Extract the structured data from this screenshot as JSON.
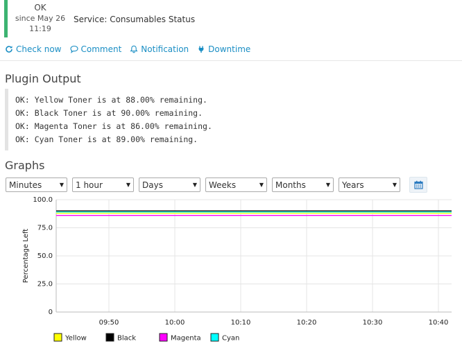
{
  "status": {
    "state": "OK",
    "since": "since May 26",
    "time": "11:19",
    "color": "#3cb371"
  },
  "service": {
    "label": "Service: Consumables Status"
  },
  "actions": [
    {
      "label": "Check now",
      "icon": "refresh-icon"
    },
    {
      "label": "Comment",
      "icon": "comment-icon"
    },
    {
      "label": "Notification",
      "icon": "bell-icon"
    },
    {
      "label": "Downtime",
      "icon": "plug-icon"
    }
  ],
  "plugin_output": {
    "title": "Plugin Output",
    "lines": [
      "OK: Yellow Toner is at 88.00% remaining.",
      "OK: Black Toner is at 90.00% remaining.",
      "OK: Magenta Toner is at 86.00% remaining.",
      "OK: Cyan Toner is at 89.00% remaining."
    ]
  },
  "graphs": {
    "title": "Graphs",
    "selects": [
      "Minutes",
      "1 hour",
      "Days",
      "Weeks",
      "Months",
      "Years"
    ],
    "calendar_icon": "calendar-icon"
  },
  "chart_data": {
    "type": "line",
    "title": "",
    "xlabel": "",
    "ylabel": "Percentage Left",
    "ylim": [
      0,
      100
    ],
    "yticks": [
      "100.0",
      "75.0",
      "50.0",
      "25.0",
      "0"
    ],
    "xlim": [
      "09:42",
      "10:42"
    ],
    "xticks": [
      "09:50",
      "10:00",
      "10:10",
      "10:20",
      "10:30",
      "10:40"
    ],
    "grid": true,
    "legend_position": "bottom-left",
    "series": [
      {
        "name": "Yellow",
        "color": "#ffff00",
        "values": [
          88,
          88
        ]
      },
      {
        "name": "Black",
        "color": "#000000",
        "values": [
          90,
          90
        ]
      },
      {
        "name": "Magenta",
        "color": "#ff00ff",
        "values": [
          86,
          86
        ]
      },
      {
        "name": "Cyan",
        "color": "#00ffff",
        "values": [
          89,
          89
        ]
      }
    ]
  }
}
